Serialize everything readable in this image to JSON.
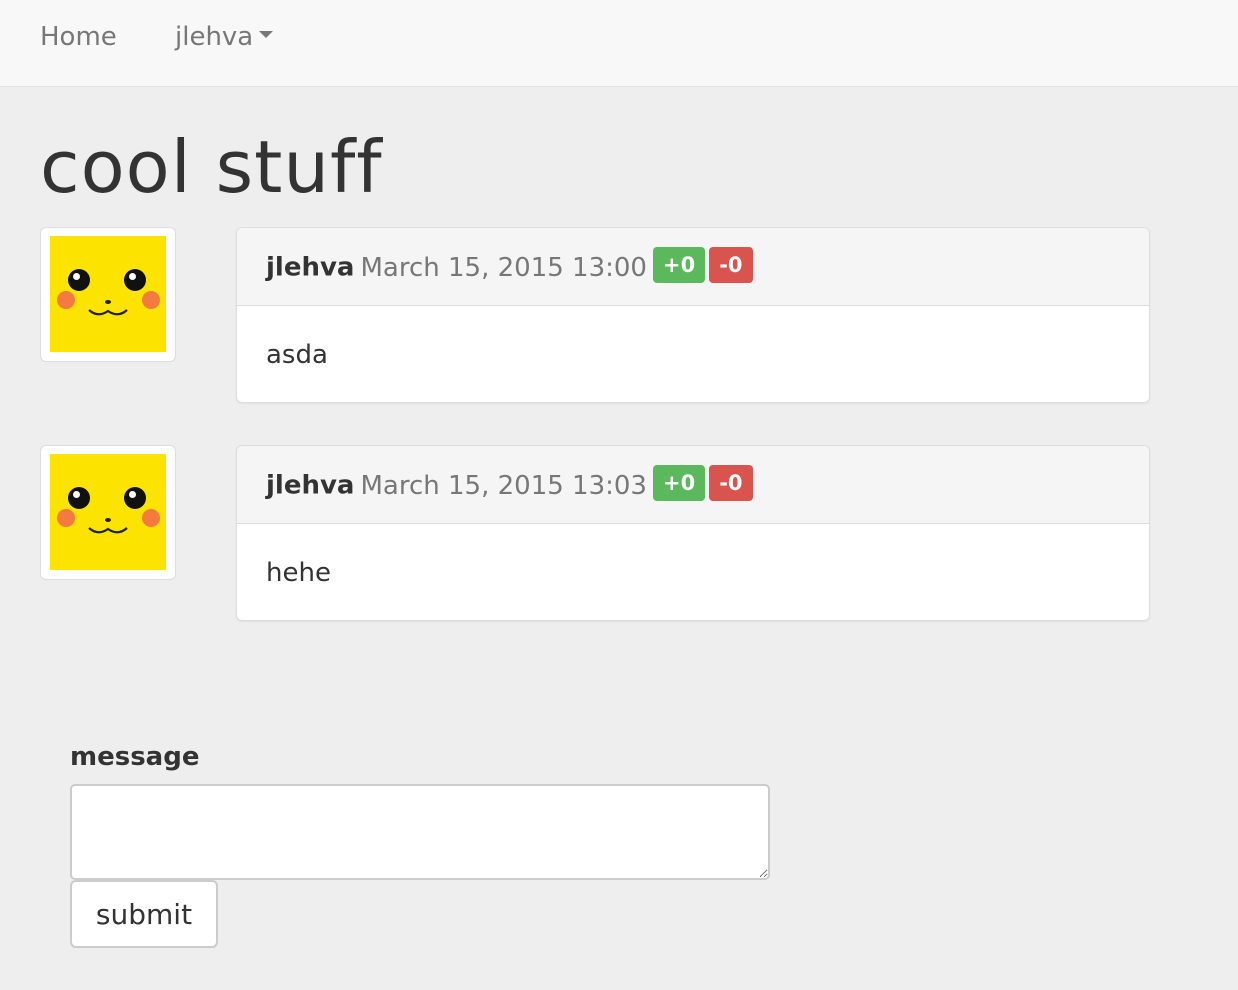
{
  "navbar": {
    "home_label": "Home",
    "user_label": "jlehva"
  },
  "page": {
    "title": "cool stuff"
  },
  "comments": [
    {
      "author": "jlehva",
      "date": "March 15, 2015 13:00",
      "upvotes": "+0",
      "downvotes": "-0",
      "body": "asda"
    },
    {
      "author": "jlehva",
      "date": "March 15, 2015 13:03",
      "upvotes": "+0",
      "downvotes": "-0",
      "body": "hehe"
    }
  ],
  "form": {
    "message_label": "message",
    "message_value": "",
    "submit_label": "submit"
  },
  "colors": {
    "upvote": "#5cb85c",
    "downvote": "#d9534f",
    "avatar_background": "#fce300"
  }
}
